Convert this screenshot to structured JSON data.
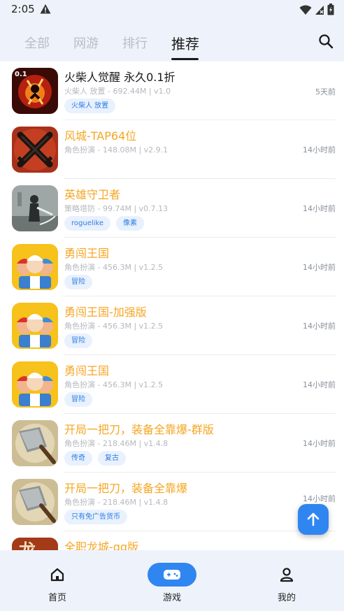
{
  "status": {
    "time": "2:05"
  },
  "tabs": [
    {
      "label": "全部"
    },
    {
      "label": "网游"
    },
    {
      "label": "排行"
    },
    {
      "label": "推荐"
    }
  ],
  "apps": [
    {
      "title": "火柴人觉醒 永久0.1折",
      "meta": "火柴人 放置 - 692.44M | v1.0",
      "tags": [
        "火柴人 放置"
      ],
      "time": "5天前",
      "title_color": "#1a1a1a"
    },
    {
      "title": "风城-TAP64位",
      "meta": "角色扮演 - 148.08M | v2.9.1",
      "tags": [],
      "time": "14小时前",
      "title_color": "#f5a623"
    },
    {
      "title": "英雄守卫者",
      "meta": "策略塔防 - 99.74M | v0.7.13",
      "tags": [
        "roguelike",
        "像素"
      ],
      "time": "14小时前",
      "title_color": "#f5a623"
    },
    {
      "title": "勇闯王国",
      "meta": "角色扮演 - 456.3M | v1.2.5",
      "tags": [
        "冒险"
      ],
      "time": "14小时前",
      "title_color": "#f5a623"
    },
    {
      "title": "勇闯王国-加强版",
      "meta": "角色扮演 - 456.3M | v1.2.5",
      "tags": [
        "冒险"
      ],
      "time": "14小时前",
      "title_color": "#f5a623"
    },
    {
      "title": "勇闯王国",
      "meta": "角色扮演 - 456.3M | v1.2.5",
      "tags": [
        "冒险"
      ],
      "time": "14小时前",
      "title_color": "#f5a623"
    },
    {
      "title": "开局一把刀，装备全靠爆-群版",
      "meta": "角色扮演 - 218.46M | v1.4.8",
      "tags": [
        "传奇",
        "复古"
      ],
      "time": "14小时前",
      "title_color": "#f5a623"
    },
    {
      "title": "开局一把刀，装备全靠爆",
      "meta": "角色扮演 - 218.46M | v1.4.8",
      "tags": [
        "只有免广告货币"
      ],
      "time": "14小时前",
      "title_color": "#f5a623"
    },
    {
      "title": "全职龙城-qq版",
      "meta": "",
      "tags": [],
      "time": "",
      "title_color": "#f5a623"
    }
  ],
  "nav": [
    {
      "label": "首页"
    },
    {
      "label": "游戏"
    },
    {
      "label": "我的"
    }
  ],
  "colors": {
    "accent": "#2f86f0",
    "title_orange": "#f5a623",
    "tag_bg": "#e8f1fd",
    "tag_text": "#2e7de3",
    "bar_bg": "#eef3fb"
  },
  "icons": {
    "status": [
      "warning-icon",
      "wifi-icon",
      "signal-icon",
      "battery-icon"
    ],
    "search": "search-icon",
    "scroll_top": "arrow-up-icon",
    "nav": [
      "home-icon",
      "gamepad-icon",
      "person-icon"
    ],
    "apps": [
      "stickman-awaken-icon",
      "crossed-swords-icon",
      "hero-guardian-icon",
      "brave-kingdom-icon",
      "brave-kingdom-icon",
      "brave-kingdom-icon",
      "cleaver-icon",
      "cleaver-icon",
      "dragon-city-icon"
    ]
  }
}
